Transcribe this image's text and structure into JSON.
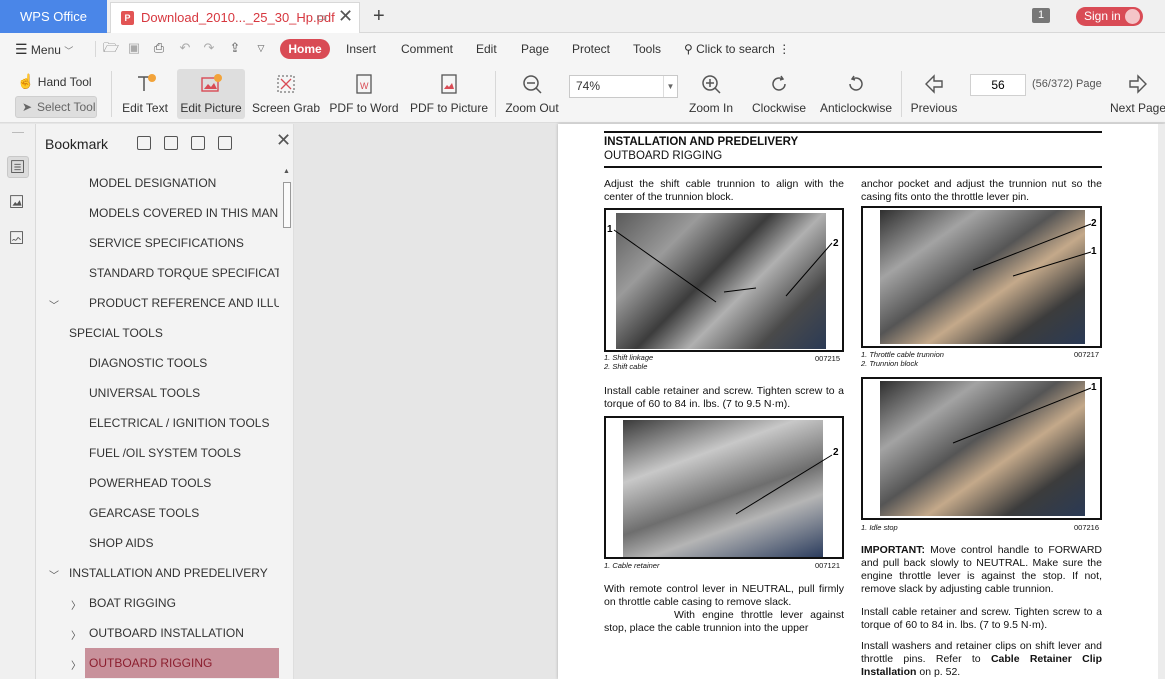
{
  "titlebar": {
    "app_tab": "WPS Office",
    "doc_tab": "Download_2010..._25_30_Hp.pdf",
    "page_count_badge": "1",
    "sign_in": "Sign in",
    "new_tab": "+",
    "close": "✕"
  },
  "menubar": {
    "menu": "Menu",
    "tabs": [
      "Home",
      "Insert",
      "Comment",
      "Edit",
      "Page",
      "Protect",
      "Tools"
    ],
    "search": "Click to search"
  },
  "ribbon": {
    "hand_tool": "Hand Tool",
    "select_tool": "Select Tool",
    "edit_text": "Edit Text",
    "edit_picture": "Edit Picture",
    "screen_grab": "Screen Grab",
    "pdf_to_word": "PDF to Word",
    "pdf_to_picture": "PDF to Picture",
    "zoom_out": "Zoom Out",
    "zoom_value": "74%",
    "zoom_in": "Zoom In",
    "clockwise": "Clockwise",
    "anticlockwise": "Anticlockwise",
    "previous": "Previous",
    "page_input": "56",
    "page_info": "(56/372) Page",
    "next_page": "Next Page"
  },
  "sidebar": {
    "title": "Bookmark",
    "items": [
      {
        "label": "MODEL DESIGNATION"
      },
      {
        "label": "MODELS COVERED IN THIS MANU..."
      },
      {
        "label": "SERVICE SPECIFICATIONS"
      },
      {
        "label": "STANDARD TORQUE SPECIFICATI..."
      },
      {
        "label": "PRODUCT REFERENCE AND ILLUS..."
      },
      {
        "label": "SPECIAL TOOLS"
      },
      {
        "label": "DIAGNOSTIC TOOLS"
      },
      {
        "label": "UNIVERSAL TOOLS"
      },
      {
        "label": "ELECTRICAL / IGNITION TOOLS"
      },
      {
        "label": "FUEL /OIL SYSTEM TOOLS"
      },
      {
        "label": "POWERHEAD TOOLS"
      },
      {
        "label": "GEARCASE TOOLS"
      },
      {
        "label": "SHOP AIDS"
      },
      {
        "label": "INSTALLATION AND PREDELIVERY"
      },
      {
        "label": "BOAT RIGGING"
      },
      {
        "label": "OUTBOARD INSTALLATION"
      },
      {
        "label": "OUTBOARD RIGGING"
      }
    ]
  },
  "page": {
    "header1": "INSTALLATION AND PREDELIVERY",
    "header2": "OUTBOARD RIGGING",
    "left_p1": "Adjust the shift cable trunnion to align with the center of the trunnion block.",
    "fig1_cap1": "1.   Shift linkage",
    "fig1_cap2": "2.   Shift cable",
    "fig1_id": "007215",
    "left_p2": "Install cable retainer and screw. Tighten screw to a torque of 60 to 84 in. lbs. (7 to 9.5 N·m).",
    "fig2_cap1": "1.   Cable retainer",
    "fig2_id": "007121",
    "left_p3a": "With remote control lever in NEUTRAL, pull firmly on throttle cable casing to remove slack.",
    "left_p3b": "With engine throttle lever against stop, place the cable trunnion into the upper",
    "right_p1": "anchor pocket and adjust the trunnion nut so the casing fits onto the throttle lever pin.",
    "fig3_cap1": "1.   Throttle cable trunnion",
    "fig3_cap2": "2.   Trunnion block",
    "fig3_id": "007217",
    "fig4_cap1": "1.   Idle stop",
    "fig4_id": "007216",
    "important_label": "IMPORTANT:",
    "important_text": " Move control handle to FORWARD and pull back slowly to NEUTRAL. Make sure the engine throttle lever is against the stop. If not, remove slack by adjusting cable trunnion.",
    "right_p2": "Install cable retainer and screw. Tighten screw to a torque of 60 to 84 in. lbs. (7 to 9.5 N·m).",
    "right_p3a": "Install washers and retainer clips on shift lever and throttle pins. Refer to ",
    "right_p3b": "Cable Retainer Clip Installation",
    "right_p3c": " on p. 52.",
    "callout_1": "1",
    "callout_2": "2"
  }
}
